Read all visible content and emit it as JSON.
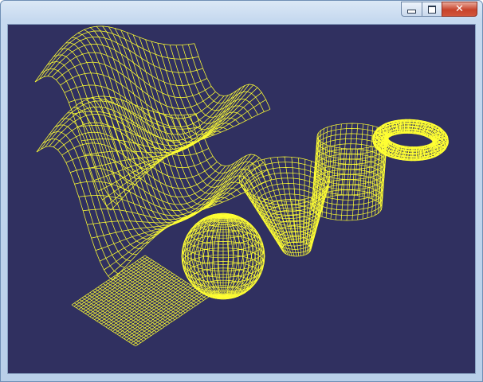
{
  "window": {
    "title": "",
    "buttons": {
      "minimize_label": "",
      "maximize_label": "",
      "close_label": "✕"
    }
  },
  "scene": {
    "background_color": "#303060",
    "wire_color": "#ffff33",
    "objects": [
      "wave-surface-upper",
      "wave-surface-lower",
      "flat-plane",
      "sphere",
      "cone",
      "cylinder",
      "torus"
    ]
  }
}
